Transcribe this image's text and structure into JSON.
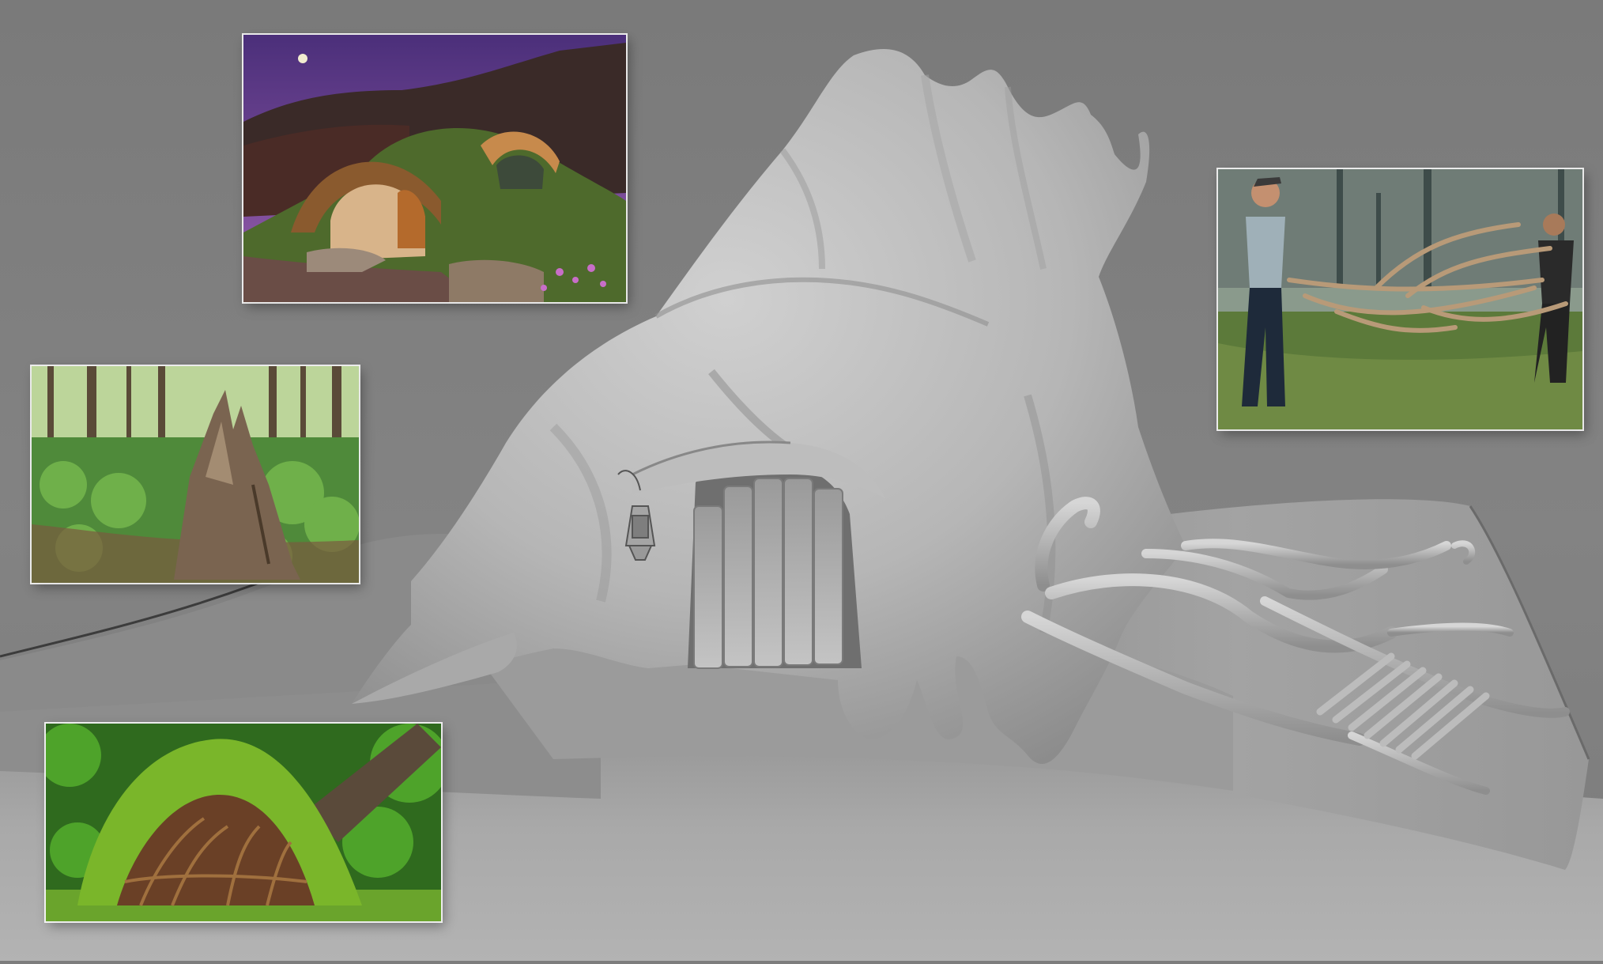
{
  "scene": {
    "subject": "tree-stump-house-3d-sculpt",
    "render_style": "clay-grey",
    "colors": {
      "background": "#7d7d7d",
      "floor": "#a7a7a7",
      "sculpt": "#b9b9b9"
    }
  },
  "reference_images": [
    {
      "id": "hobbit-house",
      "content": "earth-sheltered-cottage-at-dusk"
    },
    {
      "id": "stump",
      "content": "broken-tree-stump-in-forest"
    },
    {
      "id": "roots",
      "content": "mossy-upturned-tree-roots"
    },
    {
      "id": "branches",
      "content": "people-carrying-tree-branches"
    }
  ]
}
